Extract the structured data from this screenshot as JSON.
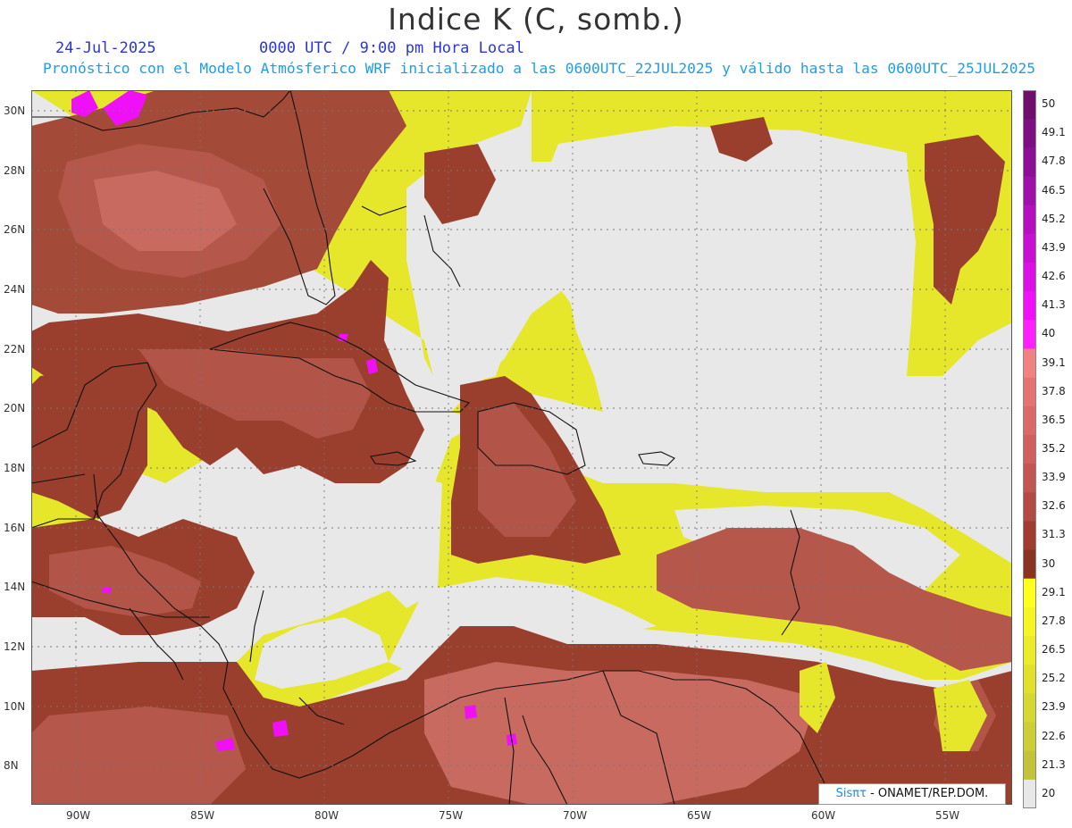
{
  "title": "Indice K (C, somb.)",
  "date": "24-Jul-2025",
  "time": "0000 UTC / 9:00 pm Hora Local",
  "subtitle": "Pronóstico con el Modelo Atmósferico WRF inicializado a las 0600UTC_22JUL2025 y válido hasta las  0600UTC_25JUL2025",
  "lat_labels": [
    "30N",
    "28N",
    "26N",
    "24N",
    "22N",
    "20N",
    "18N",
    "16N",
    "14N",
    "12N",
    "10N",
    "8N"
  ],
  "lon_labels": [
    "90W",
    "85W",
    "80W",
    "75W",
    "70W",
    "65W",
    "60W",
    "55W"
  ],
  "colorbar": {
    "labels": [
      "50",
      "49.1",
      "47.8",
      "46.5",
      "45.2",
      "43.9",
      "42.6",
      "41.3",
      "40",
      "39.1",
      "37.8",
      "36.5",
      "35.2",
      "33.9",
      "32.6",
      "31.3",
      "30",
      "29.1",
      "27.8",
      "26.5",
      "25.2",
      "23.9",
      "22.6",
      "21.3",
      "20"
    ],
    "colors": [
      "#6e0f6e",
      "#7d0f82",
      "#8c0f96",
      "#a010aa",
      "#b410be",
      "#c810d2",
      "#dc10e6",
      "#f010f8",
      "#ff20ff",
      "#f28282",
      "#e67373",
      "#dc6969",
      "#d25f5f",
      "#c35555",
      "#b44a46",
      "#a03c32",
      "#8c3220",
      "#ffff1e",
      "#f5f524",
      "#ebeb28",
      "#e1e12c",
      "#d7d732",
      "#cdcd36",
      "#c3c33a",
      "#e8e8e8"
    ]
  },
  "credit": {
    "brand": "Sisπτ",
    "text": "- ONAMET/REP.DOM."
  }
}
